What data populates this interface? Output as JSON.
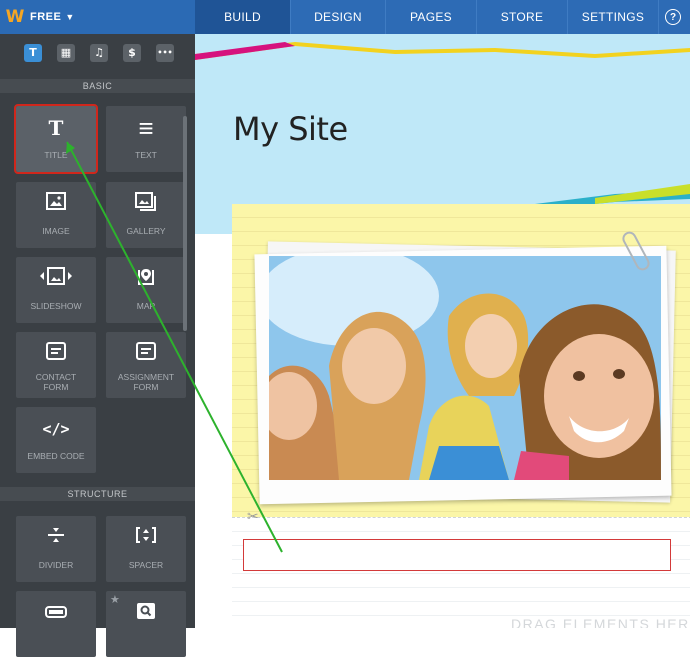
{
  "topbar": {
    "plan_label": "FREE",
    "tabs": [
      {
        "label": "BUILD"
      },
      {
        "label": "DESIGN"
      },
      {
        "label": "PAGES"
      },
      {
        "label": "STORE"
      },
      {
        "label": "SETTINGS"
      }
    ],
    "help_label": "?",
    "logo_letter": "W",
    "accent_color": "#2d6bb5",
    "logo_color": "#f5a623"
  },
  "sidebar": {
    "tab_icons": [
      "text-icon",
      "layout-icon",
      "music-icon",
      "dollar-icon",
      "more-icon"
    ],
    "tab_glyphs": [
      "T",
      "▦",
      "♫",
      "$",
      "•••"
    ],
    "sections": {
      "basic": "BASIC",
      "structure": "STRUCTURE"
    },
    "elements": [
      {
        "label": "TITLE",
        "icon": "title-icon",
        "glyph": "T",
        "selected": true
      },
      {
        "label": "TEXT",
        "icon": "text-lines-icon",
        "glyph": "≡"
      },
      {
        "label": "IMAGE",
        "icon": "image-icon",
        "glyph": "🖼"
      },
      {
        "label": "GALLERY",
        "icon": "gallery-icon",
        "glyph": "🖼"
      },
      {
        "label": "SLIDESHOW",
        "icon": "slideshow-icon",
        "glyph": "◂▣▸"
      },
      {
        "label": "MAP",
        "icon": "map-pin-icon",
        "glyph": "⌖"
      },
      {
        "label": "CONTACT\nFORM",
        "icon": "form-icon",
        "glyph": "▤"
      },
      {
        "label": "ASSIGNMENT\nFORM",
        "icon": "form-icon",
        "glyph": "▤"
      },
      {
        "label": "EMBED CODE",
        "icon": "code-icon",
        "glyph": "</>"
      }
    ],
    "structure_elements": [
      {
        "label": "DIVIDER",
        "icon": "divider-icon",
        "glyph": "÷"
      },
      {
        "label": "SPACER",
        "icon": "spacer-icon",
        "glyph": "[↕]"
      },
      {
        "label": "",
        "icon": "button-icon",
        "glyph": "▭"
      },
      {
        "label": "",
        "icon": "search-icon",
        "glyph": "🔍"
      }
    ]
  },
  "canvas": {
    "site_title": "My Site",
    "drag_hint": "DRAG ELEMENTS HERE"
  }
}
